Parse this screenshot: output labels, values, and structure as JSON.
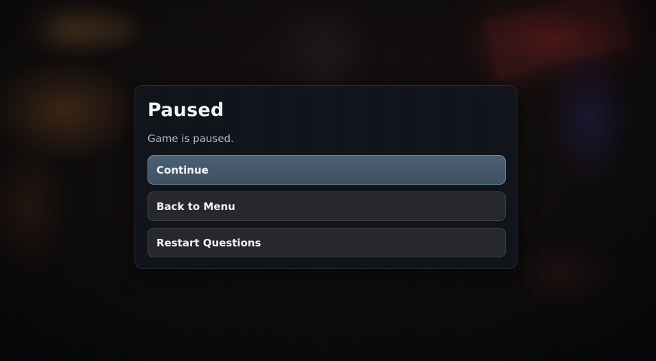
{
  "pause_menu": {
    "title": "Paused",
    "subtitle": "Game is paused.",
    "buttons": [
      {
        "label": "Continue",
        "selected": true
      },
      {
        "label": "Back to Menu",
        "selected": false
      },
      {
        "label": "Restart Questions",
        "selected": false
      }
    ]
  },
  "colors": {
    "panel_bg": "#12161d",
    "selected_button_bg": "#44596b",
    "button_bg": "#282a2e",
    "title_text": "#f1f3f6",
    "subtitle_text": "#b9bfc8"
  }
}
